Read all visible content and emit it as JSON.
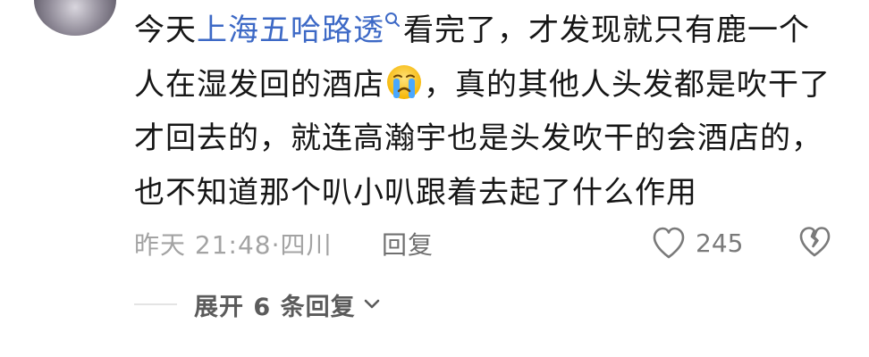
{
  "comment": {
    "text_before": "今天",
    "topic": "上海五哈路透",
    "text_after": "看完了，才发现就只有鹿一个人在湿发回的酒店",
    "text_end": "，真的其他人头发都是吹干了才回去的，就连高瀚宇也是头发吹干的会酒店的，也不知道那个叭小叭跟着去起了什么作用",
    "emoji": "crying-face"
  },
  "meta": {
    "timestamp": "昨天 21:48·四川",
    "reply_label": "回复",
    "like_count": "245"
  },
  "replies": {
    "expand_label": "展开 6 条回复"
  },
  "colors": {
    "topic": "#3d69c6",
    "text": "#161616",
    "meta": "#a3a3a3"
  }
}
